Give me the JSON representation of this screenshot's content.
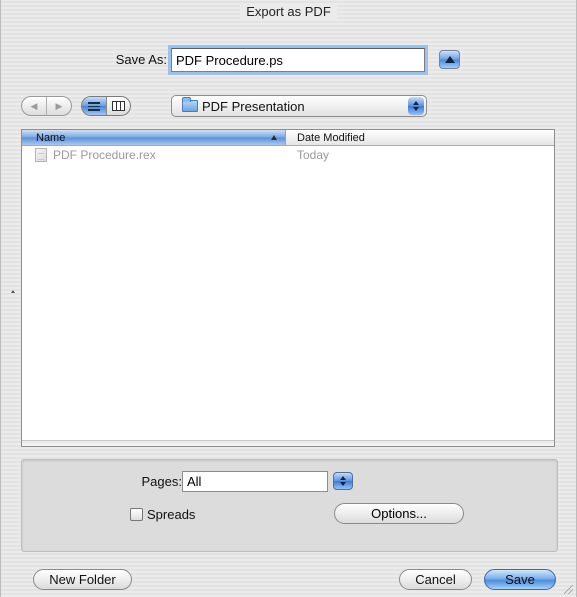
{
  "window": {
    "title": "Export as PDF"
  },
  "save_as": {
    "label": "Save As:",
    "value": "PDF Procedure.ps"
  },
  "toolbar": {
    "location": "PDF Presentation"
  },
  "browser": {
    "columns": {
      "name": "Name",
      "date": "Date Modified"
    },
    "files": [
      {
        "name": "PDF Procedure.rex",
        "date": "Today",
        "icon": "document-icon"
      }
    ]
  },
  "options": {
    "pages_label": "Pages:",
    "pages_value": "All",
    "spreads_label": "Spreads",
    "options_button": "Options..."
  },
  "buttons": {
    "new_folder": "New Folder",
    "cancel": "Cancel",
    "save": "Save"
  },
  "colors": {
    "accent": "#5c8fd7",
    "focus_ring": "#9cc1ec",
    "background": "#e9e9e9"
  }
}
